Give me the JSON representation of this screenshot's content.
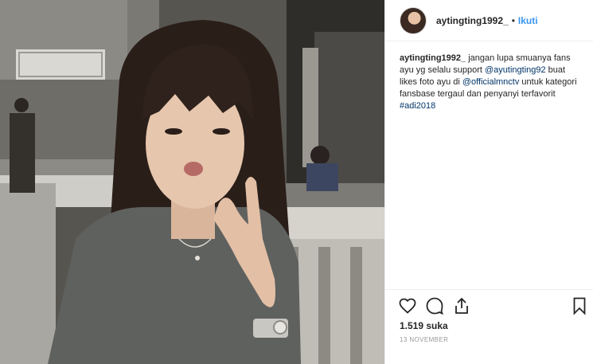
{
  "header": {
    "username": "aytingting1992_",
    "separator": "•",
    "follow_label": "Ikuti"
  },
  "caption": {
    "username": "aytingting1992_",
    "text_1": " jangan lupa smuanya fans ayu yg selalu support ",
    "mention_1": "@ayutingting92",
    "text_2": " buat likes foto ayu di ",
    "mention_2": "@officialmnctv",
    "text_3": " untuk kategori fansbase tergaul dan penyanyi terfavorit ",
    "hashtag": "#adi2018"
  },
  "footer": {
    "likes": "1.519 suka",
    "date": "13 NOVEMBER"
  },
  "icons": {
    "like": "heart-icon",
    "comment": "comment-icon",
    "share": "share-icon",
    "save": "bookmark-icon"
  },
  "colors": {
    "link": "#3897f0",
    "mention": "#003569",
    "text": "#262626",
    "muted": "#999999",
    "border": "#efefef"
  }
}
